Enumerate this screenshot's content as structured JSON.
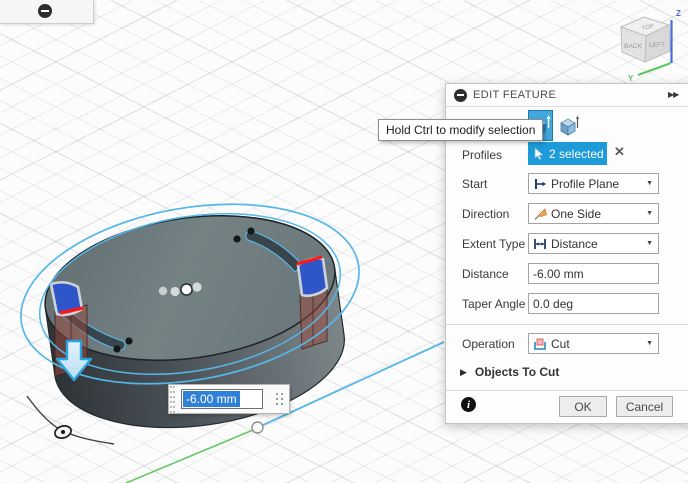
{
  "tooltip": {
    "text": "Hold Ctrl to modify selection"
  },
  "dialog": {
    "title": "EDIT FEATURE",
    "fields": [
      {
        "label": "Profiles",
        "value": "2 selected"
      },
      {
        "label": "Start",
        "value": "Profile Plane"
      },
      {
        "label": "Direction",
        "value": "One Side"
      },
      {
        "label": "Extent Type",
        "value": "Distance"
      },
      {
        "label": "Distance",
        "value": "-6.00 mm"
      },
      {
        "label": "Taper Angle",
        "value": "0.0 deg"
      },
      {
        "label": "Operation",
        "value": "Cut"
      }
    ],
    "objects_to_cut_label": "Objects To Cut",
    "ok_label": "OK",
    "cancel_label": "Cancel"
  },
  "canvas": {
    "distance_input": "-6.00 mm"
  },
  "viewcube": {
    "labels": {
      "top": "TOP",
      "back": "BACK",
      "left": "LEFT"
    },
    "axes": {
      "z": "Z",
      "y": "Y"
    }
  },
  "icons": {
    "expand_double_arrow": "▶▶",
    "dropdown_caret": "▼",
    "clear_x": "✕",
    "objects_toggle": "▶",
    "info": "i"
  },
  "colors": {
    "accent_blue": "#1d9bd8",
    "sketch_blue": "#55b7e8",
    "profile_blue": "#2e56c8",
    "highlight_red": "#ff1616",
    "cut_preview": "rgba(155,72,58,0.5)",
    "axis_green": "#61c961",
    "axis_z_blue": "#4b6bdb"
  }
}
